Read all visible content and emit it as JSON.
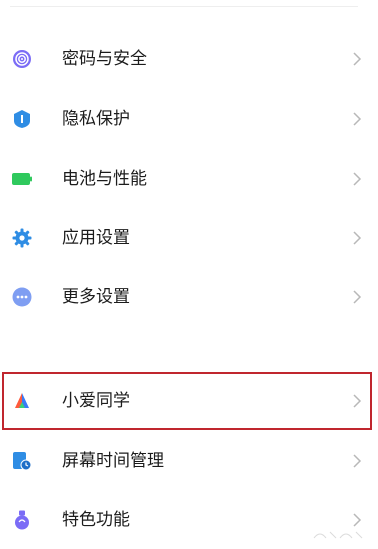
{
  "settings": {
    "items": [
      {
        "label": "密码与安全",
        "icon": "fingerprint-icon",
        "color": "#7b6cf6"
      },
      {
        "label": "隐私保护",
        "icon": "privacy-shield-icon",
        "color": "#2f8de4"
      },
      {
        "label": "电池与性能",
        "icon": "battery-icon",
        "color": "#2fc95d"
      },
      {
        "label": "应用设置",
        "icon": "gear-icon",
        "color": "#2f8de4"
      },
      {
        "label": "更多设置",
        "icon": "more-dots-icon",
        "color": "#7f9ef2"
      },
      {
        "label": "小爱同学",
        "icon": "xiaoai-icon",
        "color": "#ff5a3c"
      },
      {
        "label": "屏幕时间管理",
        "icon": "screen-time-icon",
        "color": "#2f8de4"
      },
      {
        "label": "特色功能",
        "icon": "special-features-icon",
        "color": "#7b6cf6"
      }
    ],
    "highlight_color": "#c0262e"
  }
}
